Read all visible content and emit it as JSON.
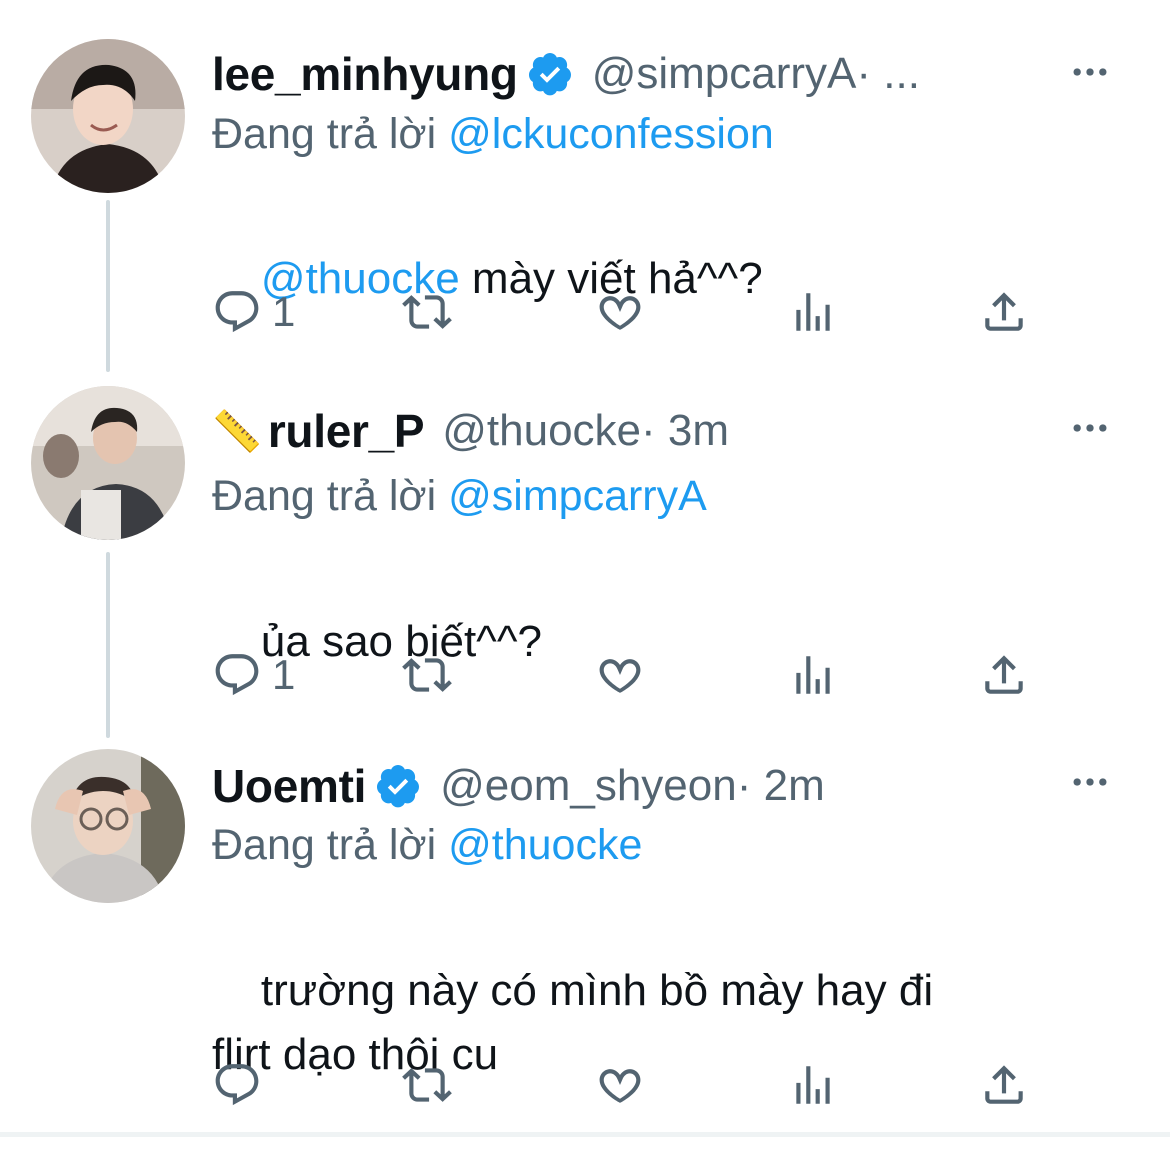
{
  "colors": {
    "accent": "#1d9bf0",
    "secondary_text": "#536471",
    "primary_text": "#0f1419"
  },
  "tweets": [
    {
      "display_name": "lee_minhyung",
      "verified": true,
      "name_emoji": "",
      "handle": "@simpcarryA",
      "time_suffix": " · ...",
      "reply_prefix": "Đang trả lời ",
      "reply_to": "@lckuconfession",
      "body_mention": "@thuocke",
      "body_text": " mày viết hả^^?",
      "reply_count": "1",
      "icons": [
        "reply-icon",
        "retweet-icon",
        "like-icon",
        "analytics-icon",
        "share-icon",
        "more-icon"
      ]
    },
    {
      "display_name": "ruler_P",
      "verified": false,
      "name_emoji": "📏",
      "handle": "@thuocke",
      "time_suffix": " · 3m",
      "reply_prefix": "Đang trả lời ",
      "reply_to": "@simpcarryA",
      "body_mention": "",
      "body_text": "ủa sao biết^^?",
      "reply_count": "1",
      "icons": [
        "reply-icon",
        "retweet-icon",
        "like-icon",
        "analytics-icon",
        "share-icon",
        "more-icon"
      ]
    },
    {
      "display_name": "Uoemti",
      "verified": true,
      "name_emoji": "",
      "handle": "@eom_shyeon",
      "time_suffix": " · 2m",
      "reply_prefix": "Đang trả lời ",
      "reply_to": "@thuocke",
      "body_mention": "",
      "body_text": "trường này có mình bồ mày hay đi\nflirt dạo thôi cu",
      "reply_count": "",
      "icons": [
        "reply-icon",
        "retweet-icon",
        "like-icon",
        "analytics-icon",
        "share-icon",
        "more-icon"
      ]
    }
  ]
}
